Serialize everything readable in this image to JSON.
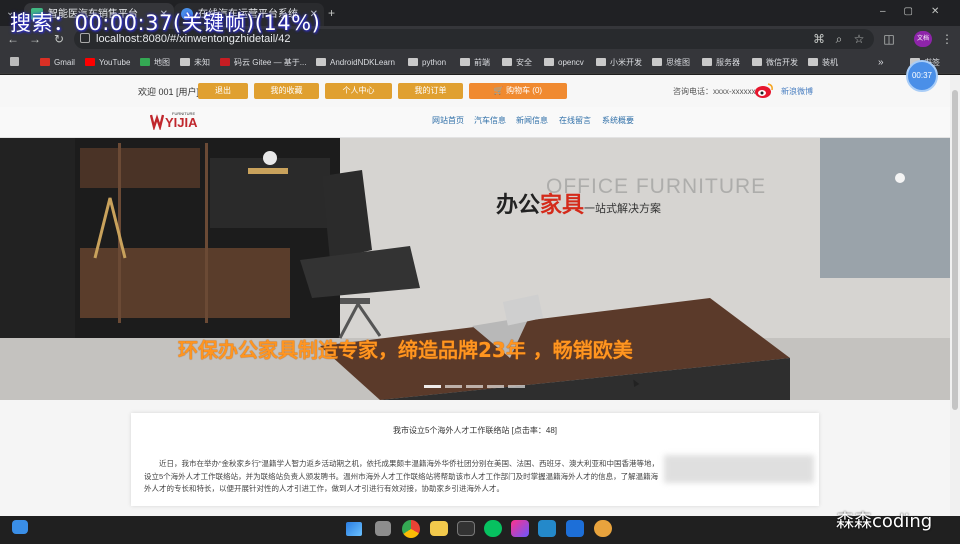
{
  "overlay": {
    "search_label": "搜索：00:00:37(关键帧)(14%)",
    "timer_badge": "00:37"
  },
  "browser": {
    "tabs": [
      {
        "title": "智能医汽车销售平台"
      },
      {
        "title": "在线汽车运营平台系统"
      }
    ],
    "new_tab": "+",
    "address": "localhost:8080/#/xinwentongzhidetail/42",
    "profile_badge": "文档",
    "bookmarks": [
      "Gmail",
      "YouTube",
      "地图",
      "未知",
      "码云 Gitee — 基于...",
      "AndroidNDKLearn",
      "python",
      "前端",
      "安全",
      "opencv",
      "小米开发",
      "思维图",
      "服务器",
      "微信开发",
      "装机"
    ],
    "bookmarks_more": "»",
    "bookmarks_right": "书签"
  },
  "site": {
    "welcome": "欢迎 001 [用户]",
    "user_buttons": [
      "退出",
      "我的收藏",
      "个人中心",
      "我的订单"
    ],
    "cart_button": "🛒 购物车  (0)",
    "hotline": "咨询电话：xxxx-xxxxxx",
    "weibo": "新浪微博",
    "logo_text": "YIJIA",
    "logo_small": "FURNITURE",
    "nav": [
      "网站首页",
      "汽车信息",
      "新闻信息",
      "在线留言",
      "系统概要"
    ],
    "banner": {
      "title_black": "办公",
      "title_red": "家具",
      "title_sub": "一站式解决方案",
      "english": "OFFICE FURNITURE",
      "slogan": "环保办公家具制造专家，缔造品牌23年 ，畅销欧美"
    },
    "article": {
      "title": "我市设立5个海外人才工作联络站 [点击率：48]",
      "body": "近日，我市在举办“金秋家乡行”温籍学人智力返乡活动期之机，依托成果颇丰温籍海外华侨社团分别在美国、法国、西班牙、澳大利亚和中国香港等地，设立5个海外人才工作联络站，并为联络站负责人颁发聘书。温州市海外人才工作联络站将帮助该市人才工作部门及时掌握温籍海外人才的信息，了解温籍海外人才的专长和特长，以便开展针对性的人才引进工作，做到人才引进行有效对接，协助家乡引进海外人才。"
    }
  },
  "watermark": "森森coding",
  "colors": {
    "accent_button": "#e0a030",
    "cart_button": "#f08a30",
    "nav_link": "#2f6fa8",
    "slogan": "#ff9520",
    "title_red": "#d42a1a"
  }
}
